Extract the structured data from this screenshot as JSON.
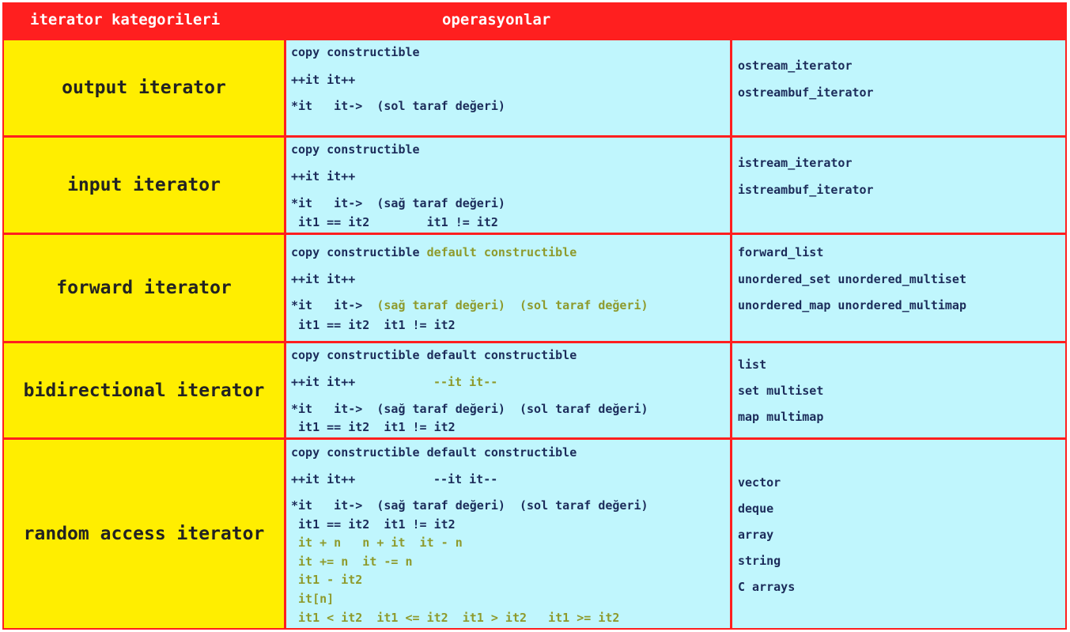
{
  "header": {
    "col_category": "iterator kategorileri",
    "col_operations": "operasyonlar"
  },
  "rows": [
    {
      "category": "output iterator",
      "ops": [
        "copy constructible",
        "++it it++",
        "*it   it->  (sol taraf değeri)"
      ],
      "containers": [
        "ostream_iterator",
        "ostreambuf_iterator"
      ]
    },
    {
      "category": "input iterator",
      "ops": [
        "copy constructible",
        "++it it++",
        "*it   it->  (sağ taraf değeri)",
        " it1 == it2        it1 != it2"
      ],
      "containers": [
        "istream_iterator",
        "istreambuf_iterator"
      ]
    },
    {
      "category": "forward iterator",
      "ops": [
        "copy constructible",
        "default constructible",
        "++it it++",
        "*it   it->  ",
        "(sağ taraf değeri)  (sol taraf değeri)",
        " it1 == it2  it1 != it2"
      ],
      "containers": [
        "forward_list",
        "unordered_set unordered_multiset",
        "unordered_map unordered_multimap"
      ]
    },
    {
      "category": "bidirectional iterator",
      "ops": [
        "copy constructible default constructible",
        "++it it++",
        "--it it--",
        "*it   it->  (sağ taraf değeri)  (sol taraf değeri)",
        " it1 == it2  it1 != it2"
      ],
      "containers": [
        "list",
        "set multiset",
        "map multimap"
      ]
    },
    {
      "category": "random access iterator",
      "ops": [
        "copy constructible default constructible",
        "++it it++",
        "--it it--",
        "*it   it->  (sağ taraf değeri)  (sol taraf değeri)",
        " it1 == it2  it1 != it2",
        " it + n   n + it  it - n",
        " it += n  it -= n",
        " it1 - it2",
        " it[n]",
        " it1 < it2  it1 <= it2  it1 > it2   it1 >= it2"
      ],
      "containers": [
        "vector",
        "deque",
        "array",
        "string",
        "C arrays"
      ]
    }
  ],
  "colors": {
    "border": "#ff1f1f",
    "category_bg": "#ffee00",
    "cell_bg": "#c0f6fd",
    "text": "#1c2c5a",
    "highlight": "#8e9a2c"
  }
}
